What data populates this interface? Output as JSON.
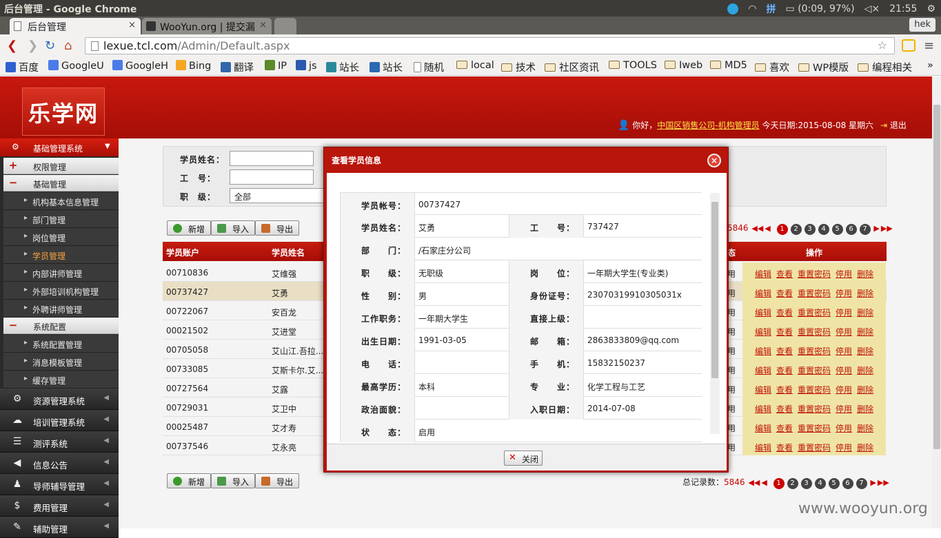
{
  "os": {
    "window_title": "后台管理 - Google Chrome",
    "battery": "(0:09, 97%)",
    "clock": "21:55",
    "ime": "拼"
  },
  "browser": {
    "tabs": [
      {
        "label": "后台管理",
        "active": true
      },
      {
        "label": "WooYun.org | 提交漏",
        "active": false
      }
    ],
    "user": "hek",
    "url_host": "lexue.tcl.com",
    "url_path": "/Admin/Default.aspx",
    "bookmarks": [
      "百度",
      "GoogleU",
      "GoogleH",
      "Bing",
      "翻译",
      "IP",
      "js",
      "站长",
      "站长",
      "随机",
      "local",
      "技术",
      "社区资讯",
      "TOOLS",
      "Iweb",
      "MD5",
      "喜欢",
      "WP模版",
      "编程相关"
    ],
    "more": "»"
  },
  "header": {
    "logo": "乐学网",
    "greeting": "你好，",
    "org_user": "中国区销售公司-机构管理员",
    "date": "今天日期:2015-08-08 星期六",
    "logout": "退出"
  },
  "sidebar": {
    "top": "基础管理系统",
    "subs": [
      {
        "label": "权限管理",
        "sign": "+"
      },
      {
        "label": "基础管理",
        "sign": "−"
      }
    ],
    "leaves1": [
      "机构基本信息管理",
      "部门管理",
      "岗位管理",
      "学员管理",
      "内部讲师管理",
      "外部培训机构管理",
      "外聘讲师管理"
    ],
    "sub3": {
      "label": "系统配置",
      "sign": "−"
    },
    "leaves2": [
      "系统配置管理",
      "消息模板管理",
      "缓存管理"
    ],
    "modules": [
      "资源管理系统",
      "培训管理系统",
      "测评系统",
      "信息公告",
      "导师辅导管理",
      "费用管理",
      "辅助管理"
    ]
  },
  "search": {
    "name_label": "学员姓名：",
    "id_label": "工　号：",
    "level_label": "职　级：",
    "level_value": "全部"
  },
  "toolbar": {
    "add": "新增",
    "import": "导入",
    "export": "导出"
  },
  "pager": {
    "total_label": "总记录数：",
    "total": "5846",
    "pages": [
      "1",
      "2",
      "3",
      "4",
      "5",
      "6",
      "7"
    ]
  },
  "grid": {
    "headers": {
      "account": "学员账户",
      "name": "学员姓名",
      "status": "态",
      "ops": "操作"
    },
    "rows": [
      {
        "account": "00710836",
        "name": "艾维强",
        "status": "用"
      },
      {
        "account": "00737427",
        "name": "艾勇",
        "status": "用"
      },
      {
        "account": "00722067",
        "name": "安百龙",
        "status": "用"
      },
      {
        "account": "00021502",
        "name": "艾进堂",
        "status": "用"
      },
      {
        "account": "00705058",
        "name": "艾山江.吾拉...",
        "status": "用"
      },
      {
        "account": "00733085",
        "name": "艾斯卡尔.艾...",
        "status": "用"
      },
      {
        "account": "00727564",
        "name": "艾露",
        "status": "用"
      },
      {
        "account": "00729031",
        "name": "艾卫中",
        "status": "用"
      },
      {
        "account": "00025487",
        "name": "艾才寿",
        "status": "用"
      },
      {
        "account": "00737546",
        "name": "艾永亮",
        "status": "用"
      }
    ],
    "ops": [
      "编辑",
      "查看",
      "重置密码",
      "停用",
      "删除"
    ]
  },
  "modal": {
    "title": "查看学员信息",
    "close_label": "关闭",
    "rows": [
      {
        "l1": "学员帐号：",
        "v1": "00737427"
      },
      {
        "l1": "学员姓名：",
        "v1": "艾勇",
        "l2": "工　　号：",
        "v2": "737427"
      },
      {
        "l1": "部　　门：",
        "v1": "/石家庄分公司"
      },
      {
        "l1": "职　　级：",
        "v1": "无职级",
        "l2": "岗　　位：",
        "v2": "一年期大学生(专业类)"
      },
      {
        "l1": "性　　别：",
        "v1": "男",
        "l2": "身份证号：",
        "v2": "23070319910305031x"
      },
      {
        "l1": "工作职务：",
        "v1": "一年期大学生",
        "l2": "直接上级：",
        "v2": ""
      },
      {
        "l1": "出生日期：",
        "v1": "1991-03-05",
        "l2": "邮　　箱：",
        "v2": "2863833809@qq.com"
      },
      {
        "l1": "电　　话：",
        "v1": "",
        "l2": "手　　机：",
        "v2": "15832150237"
      },
      {
        "l1": "最高学历：",
        "v1": "本科",
        "l2": "专　　业：",
        "v2": "化学工程与工艺"
      },
      {
        "l1": "政治面貌：",
        "v1": "",
        "l2": "入职日期：",
        "v2": "2014-07-08"
      },
      {
        "l1": "状　　态：",
        "v1": "启用"
      }
    ]
  },
  "watermark": "www.wooyun.org",
  "colors": {
    "brand_red": "#b8150b",
    "link_red": "#c0140a",
    "selected_row": "#e9dfc5"
  }
}
